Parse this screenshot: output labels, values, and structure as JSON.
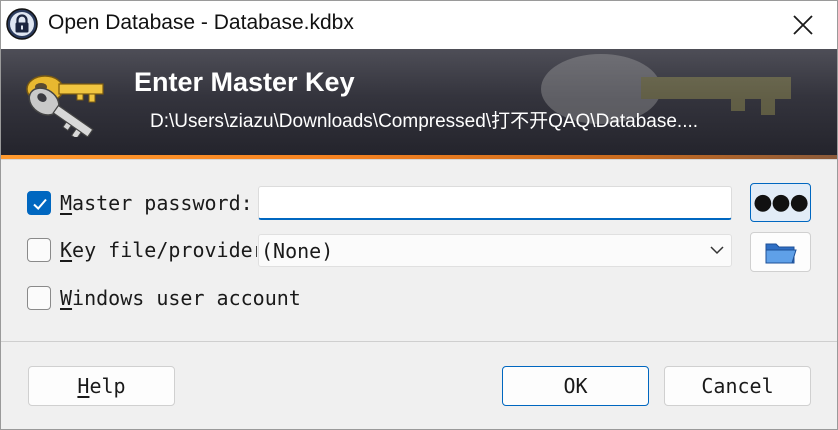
{
  "window": {
    "title": "Open Database - Database.kdbx",
    "close_glyph": "✕"
  },
  "banner": {
    "title": "Enter Master Key",
    "path": "D:\\Users\\ziazu\\Downloads\\Compressed\\打不开QAQ\\Database...."
  },
  "master_password": {
    "checked": true,
    "label_mnemonic": "M",
    "label_rest": "aster password:",
    "value": "",
    "reveal_button_glyph": "●●●"
  },
  "key_file": {
    "checked": false,
    "label_mnemonic": "K",
    "label_rest": "ey file/provider:",
    "selected": "(None)"
  },
  "windows_account": {
    "checked": false,
    "label_mnemonic": "W",
    "label_rest": "indows user account"
  },
  "buttons": {
    "help_mnemonic": "H",
    "help_rest": "elp",
    "ok": "OK",
    "cancel": "Cancel"
  },
  "colors": {
    "accent": "#0067c0",
    "banner_stripe": "#f58220",
    "banner_bg": "#34343d"
  },
  "icons": [
    "lock-icon",
    "close-icon",
    "keys-icon",
    "checkmark-icon",
    "chevron-down-icon",
    "folder-icon"
  ]
}
